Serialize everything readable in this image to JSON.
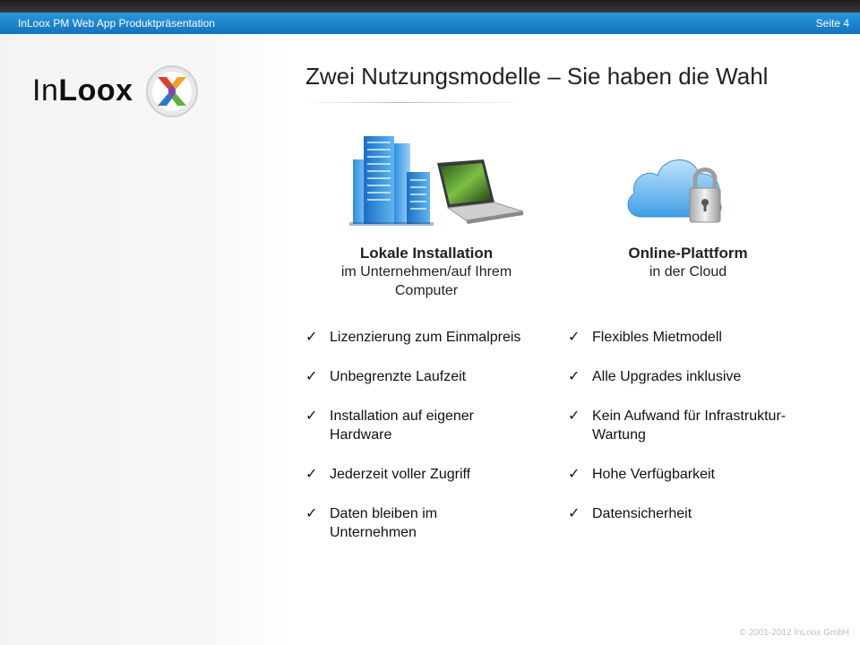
{
  "header": {
    "presentation_title": "InLoox PM Web App Produktpräsentation",
    "page_label": "Seite 4"
  },
  "logo": {
    "text_regular": "In",
    "text_bold": "Loox"
  },
  "slide": {
    "title": "Zwei Nutzungsmodelle – Sie haben die Wahl"
  },
  "columns": [
    {
      "heading": "Lokale Installation",
      "subheading": "im Unternehmen/auf Ihrem Computer",
      "image_icon": "office-building-laptop-icon",
      "items": [
        "Lizenzierung zum Einmalpreis",
        "Unbegrenzte Laufzeit",
        "Installation auf eigener Hardware",
        "Jederzeit voller Zugriff",
        "Daten bleiben im Unternehmen"
      ]
    },
    {
      "heading": "Online-Plattform",
      "subheading": "in der Cloud",
      "image_icon": "cloud-padlock-icon",
      "items": [
        "Flexibles Mietmodell",
        "Alle Upgrades inklusive",
        "Kein Aufwand für Infrastruktur-Wartung",
        "Hohe Verfügbarkeit",
        "Datensicherheit"
      ]
    }
  ],
  "footer": {
    "copyright": "© 2001-2012 InLoox GmbH"
  },
  "colors": {
    "header_blue": "#1a84cf",
    "header_dark": "#2a2a2a",
    "text": "#222222"
  }
}
